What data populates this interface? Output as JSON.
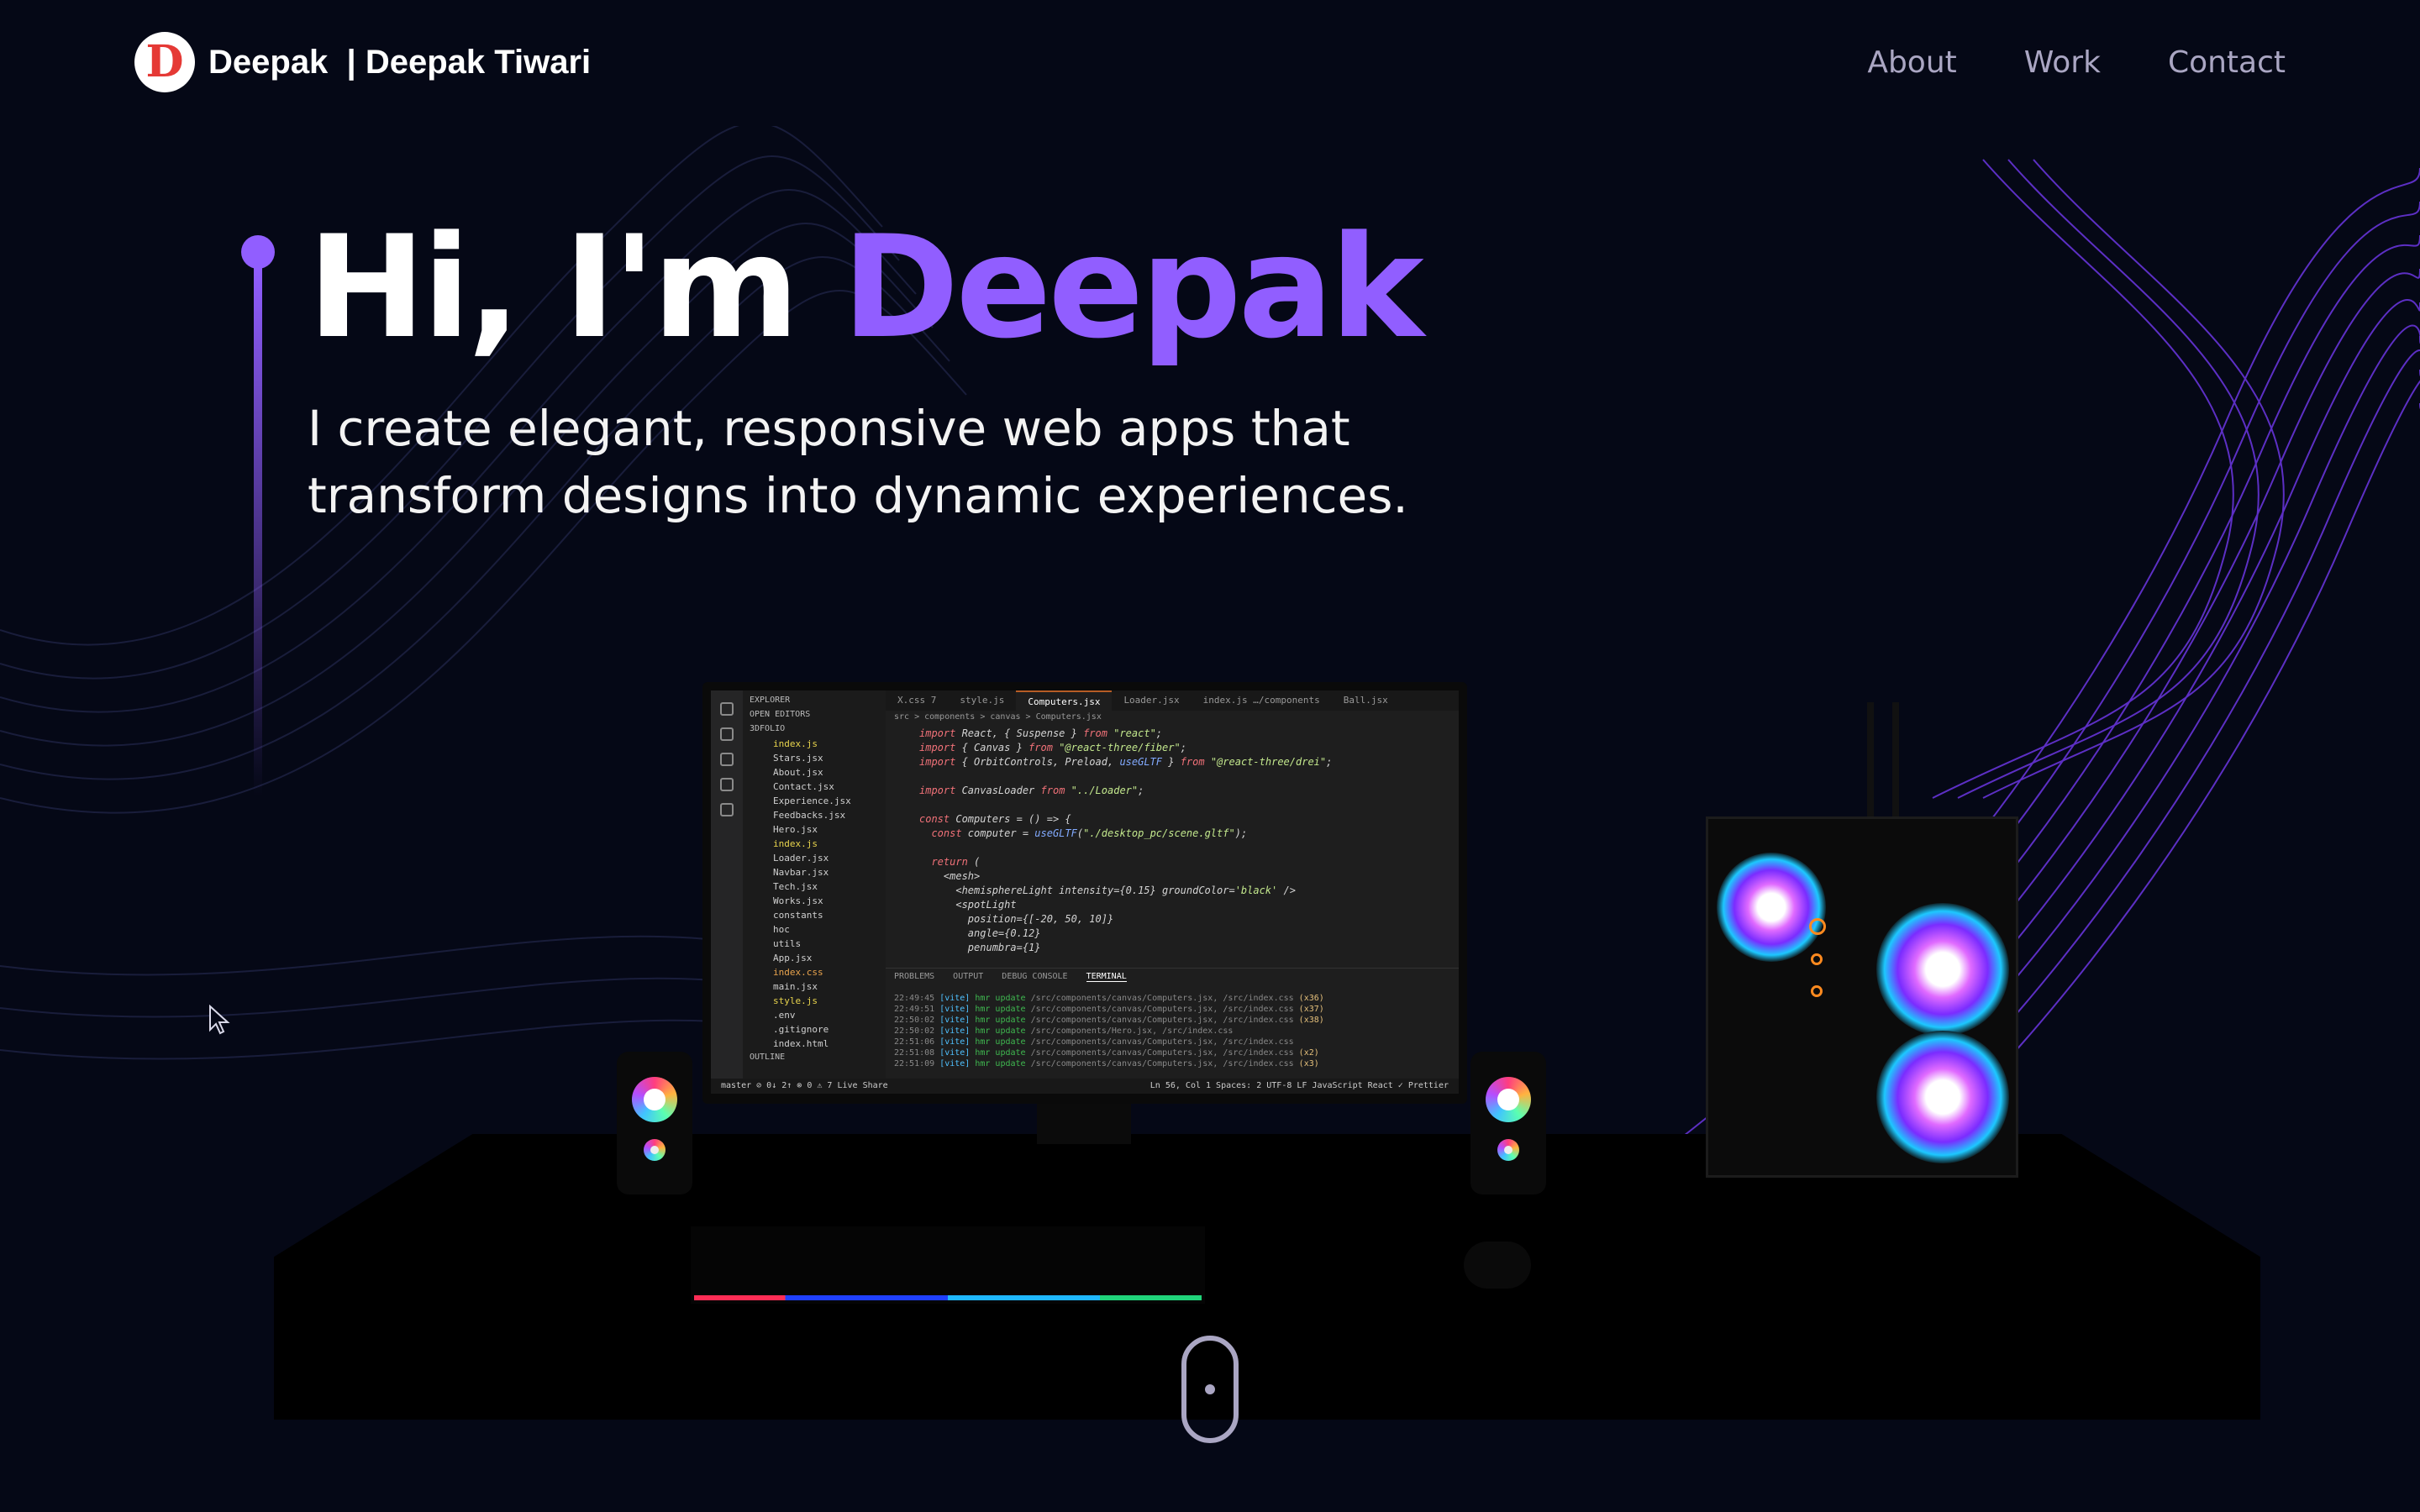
{
  "navbar": {
    "logo_letter": "D",
    "brand": "Deepak  | Deepak Tiwari",
    "links": [
      "About",
      "Work",
      "Contact"
    ]
  },
  "hero": {
    "greeting": "Hi, I'm ",
    "name": "Deepak",
    "subtitle_line1": "I create elegant, responsive web apps that",
    "subtitle_line2": "transform designs into dynamic experiences."
  },
  "colors": {
    "background": "#050816",
    "accent": "#915eff",
    "nav_link": "#aaa6c3"
  },
  "editor": {
    "explorer_title": "EXPLORER",
    "open_editors": "OPEN EDITORS",
    "project": "3DFOLIO",
    "files": [
      "index.js",
      "Stars.jsx",
      "About.jsx",
      "Contact.jsx",
      "Experience.jsx",
      "Feedbacks.jsx",
      "Hero.jsx",
      "index.js",
      "Loader.jsx",
      "Navbar.jsx",
      "Tech.jsx",
      "Works.jsx",
      "constants",
      "hoc",
      "utils",
      "App.jsx",
      "index.css",
      "main.jsx",
      "style.js",
      ".env",
      ".gitignore",
      "index.html"
    ],
    "outline": "OUTLINE",
    "tabs": [
      "X.css 7",
      "style.js",
      "Computers.jsx",
      "Loader.jsx",
      "index.js …/components",
      "Ball.jsx"
    ],
    "breadcrumb": "src > components > canvas > Computers.jsx",
    "code_lines": [
      [
        "import React, { Suspense } from \"react\";"
      ],
      [
        "import { Canvas } from \"@react-three/fiber\";"
      ],
      [
        "import { OrbitControls, Preload, useGLTF } from \"@react-three/drei\";"
      ],
      [
        ""
      ],
      [
        "import CanvasLoader from \"../Loader\";"
      ],
      [
        ""
      ],
      [
        "const Computers = () => {"
      ],
      [
        "  const computer = useGLTF(\"./desktop_pc/scene.gltf\");"
      ],
      [
        ""
      ],
      [
        "  return ("
      ],
      [
        "    <mesh>"
      ],
      [
        "      <hemisphereLight intensity={0.15} groundColor='black' />"
      ],
      [
        "      <spotLight"
      ],
      [
        "        position={[-20, 50, 10]}"
      ],
      [
        "        angle={0.12}"
      ],
      [
        "        penumbra={1}"
      ]
    ],
    "panel_tabs": [
      "PROBLEMS",
      "OUTPUT",
      "DEBUG CONSOLE",
      "TERMINAL"
    ],
    "terminal": [
      {
        "time": "22:49:45",
        "file": "/src/components/canvas/Computers.jsx, /src/index.css",
        "count": "(x36)"
      },
      {
        "time": "22:49:51",
        "file": "/src/components/canvas/Computers.jsx, /src/index.css",
        "count": "(x37)"
      },
      {
        "time": "22:50:02",
        "file": "/src/components/canvas/Computers.jsx, /src/index.css",
        "count": "(x38)"
      },
      {
        "time": "22:50:02",
        "file": "/src/components/Hero.jsx, /src/index.css",
        "count": ""
      },
      {
        "time": "22:51:06",
        "file": "/src/components/canvas/Computers.jsx, /src/index.css",
        "count": ""
      },
      {
        "time": "22:51:08",
        "file": "/src/components/canvas/Computers.jsx, /src/index.css",
        "count": "(x2)"
      },
      {
        "time": "22:51:09",
        "file": "/src/components/canvas/Computers.jsx, /src/index.css",
        "count": "(x3)"
      }
    ],
    "status_left": "master   ⊘ 0↓ 2↑   ⊗ 0 ⚠ 7   Live Share",
    "status_right": "Ln 56, Col 1   Spaces: 2   UTF-8   LF   JavaScript React   ✓ Prettier"
  }
}
